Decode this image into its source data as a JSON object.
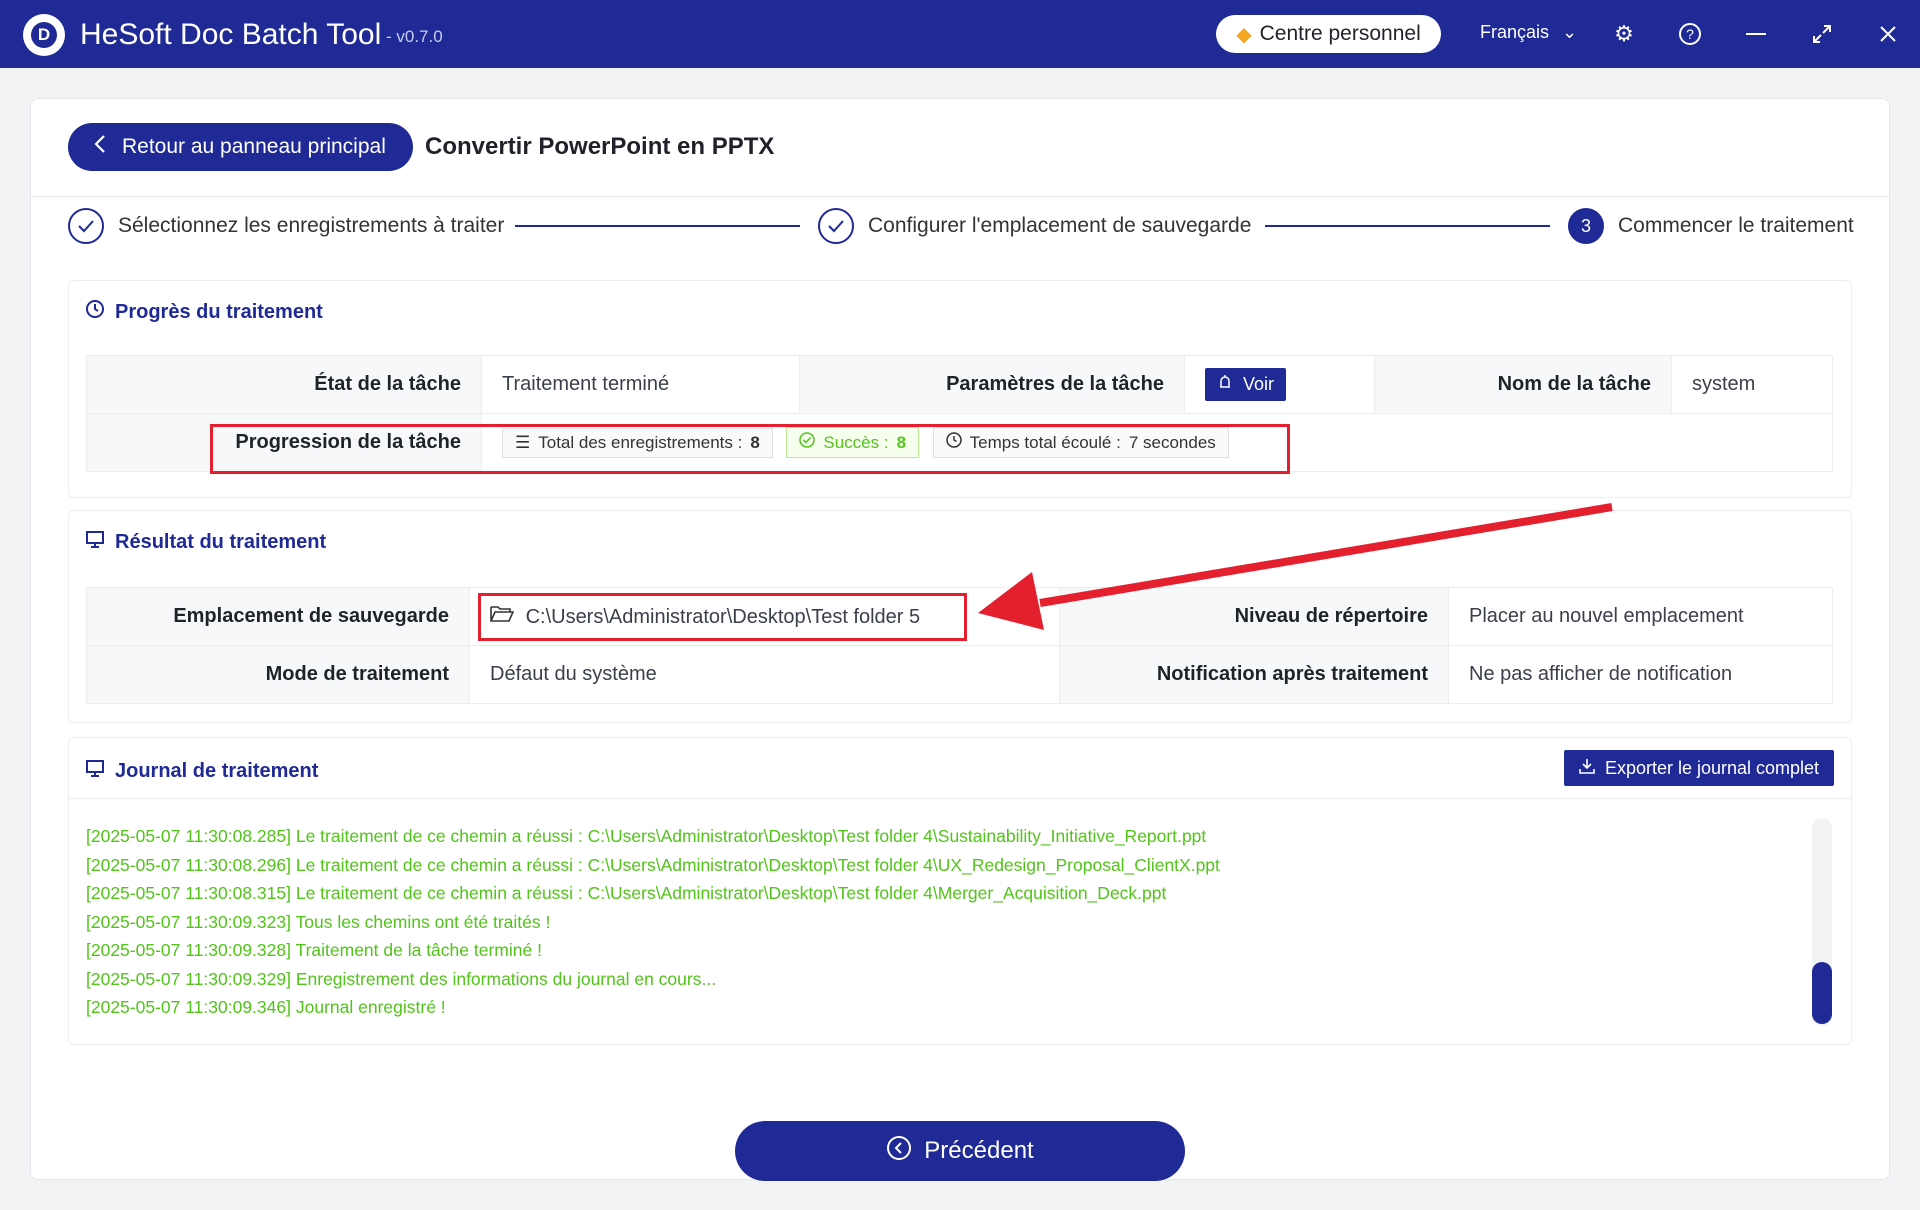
{
  "app": {
    "title": "HeSoft Doc Batch Tool",
    "version": "- v0.7.0",
    "personal_center": "Centre personnel",
    "language": "Français"
  },
  "header": {
    "back_label": "Retour au panneau principal",
    "page_title": "Convertir PowerPoint en PPTX"
  },
  "steps": [
    {
      "label": "Sélectionnez les enregistrements à traiter",
      "status": "done"
    },
    {
      "label": "Configurer l'emplacement de sauvegarde",
      "status": "done"
    },
    {
      "number": "3",
      "label": "Commencer le traitement",
      "status": "active"
    }
  ],
  "progress": {
    "title": "Progrès du traitement",
    "task_state_label": "État de la tâche",
    "task_state_value": "Traitement terminé",
    "task_params_label": "Paramètres de la tâche",
    "view_label": "Voir",
    "task_name_label": "Nom de la tâche",
    "task_name_value": "system",
    "task_progress_label": "Progression de la tâche",
    "total_label": "Total des enregistrements :",
    "total_value": "8",
    "success_label": "Succès :",
    "success_value": "8",
    "elapsed_label": "Temps total écoulé :",
    "elapsed_value": "7 secondes"
  },
  "result": {
    "title": "Résultat du traitement",
    "save_location_label": "Emplacement de sauvegarde",
    "save_location_value": "C:\\Users\\Administrator\\Desktop\\Test folder 5",
    "dir_level_label": "Niveau de répertoire",
    "dir_level_value": "Placer au nouvel emplacement",
    "mode_label": "Mode de traitement",
    "mode_value": "Défaut du système",
    "notify_label": "Notification après traitement",
    "notify_value": "Ne pas afficher de notification"
  },
  "journal": {
    "title": "Journal de traitement",
    "export_label": "Exporter le journal complet",
    "lines": [
      "[2025-05-07 11:30:08.285] Le traitement de ce chemin a réussi : C:\\Users\\Administrator\\Desktop\\Test folder 4\\Sustainability_Initiative_Report.ppt",
      "[2025-05-07 11:30:08.296] Le traitement de ce chemin a réussi : C:\\Users\\Administrator\\Desktop\\Test folder 4\\UX_Redesign_Proposal_ClientX.ppt",
      "[2025-05-07 11:30:08.315] Le traitement de ce chemin a réussi : C:\\Users\\Administrator\\Desktop\\Test folder 4\\Merger_Acquisition_Deck.ppt",
      "[2025-05-07 11:30:09.323] Tous les chemins ont été traités !",
      "[2025-05-07 11:30:09.328] Traitement de la tâche terminé !",
      "[2025-05-07 11:30:09.329] Enregistrement des informations du journal en cours...",
      "[2025-05-07 11:30:09.346] Journal enregistré !"
    ]
  },
  "footer": {
    "prev_label": "Précédent"
  },
  "colors": {
    "primary": "#1f2a96",
    "success": "#52c41a",
    "highlight": "#e5202e"
  }
}
